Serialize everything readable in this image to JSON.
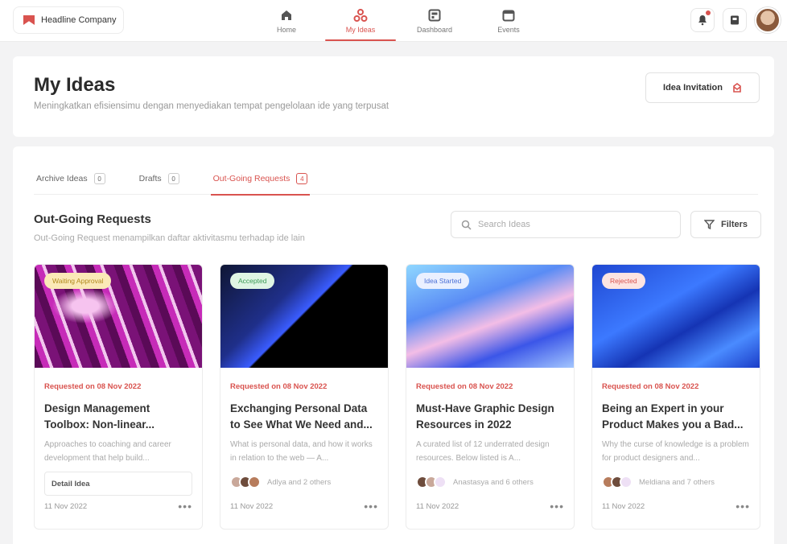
{
  "topbar": {
    "brand": "Headline Company",
    "nav": [
      {
        "label": "Home",
        "icon": "home-icon",
        "active": false
      },
      {
        "label": "My Ideas",
        "icon": "ideas-icon",
        "active": true
      },
      {
        "label": "Dashboard",
        "icon": "dashboard-icon",
        "active": false
      },
      {
        "label": "Events",
        "icon": "calendar-icon",
        "active": false
      }
    ],
    "icons": [
      "notification-icon",
      "bookmark-icon",
      "profile-avatar"
    ]
  },
  "header": {
    "title": "My Ideas",
    "subtitle": "Meningkatkan efisiensimu dengan menyediakan tempat pengelolaan ide yang terpusat",
    "invite_button": "Idea Invitation"
  },
  "tabs": [
    {
      "label": "Archive Ideas",
      "count": "0",
      "active": false
    },
    {
      "label": "Drafts",
      "count": "0",
      "active": false
    },
    {
      "label": "Out-Going Requests",
      "count": "4",
      "active": true
    }
  ],
  "section": {
    "title": "Out-Going Requests",
    "subtitle": "Out-Going Request menampilkan daftar aktivitasmu terhadap ide lain",
    "search_placeholder": "Search Ideas",
    "filter_label": "Filters"
  },
  "cards": [
    {
      "badge": "Waiting Approval",
      "badge_bg": "#fbe9b7",
      "badge_color": "#b0891d",
      "requested": "Requested on 08 Nov 2022",
      "title": "Design Management Toolbox: Non-linear...",
      "description": "Approaches to coaching and career development that help build...",
      "people": "",
      "detail_label": "Detail Idea",
      "date": "11 Nov 2022"
    },
    {
      "badge": "Accepted",
      "badge_bg": "#dff5e4",
      "badge_color": "#3b9a55",
      "requested": "Requested on 08 Nov 2022",
      "title": "Exchanging Personal Data to See What We Need and...",
      "description": "What is personal data, and how it works in relation to the web — A...",
      "people": "Adlya and 2 others",
      "detail_label": "",
      "date": "11 Nov 2022"
    },
    {
      "badge": "Idea Started",
      "badge_bg": "#eaf0ff",
      "badge_color": "#4a6fd6",
      "requested": "Requested on 08 Nov 2022",
      "title": "Must-Have Graphic Design Resources in 2022",
      "description": "A curated list of 12 underrated design resources. Below listed is A...",
      "people": "Anastasya and 6 others",
      "detail_label": "",
      "date": "11 Nov 2022"
    },
    {
      "badge": "Rejected",
      "badge_bg": "#fde4e2",
      "badge_color": "#d9534f",
      "requested": "Requested on 08 Nov 2022",
      "title": "Being an Expert in your Product Makes you a Bad...",
      "description": "Why the curse of knowledge is a problem for product designers and...",
      "people": "Meldiana and 7 others",
      "detail_label": "",
      "date": "11 Nov 2022"
    }
  ],
  "colors": {
    "accent": "#d9534f",
    "background": "#f3f3f4"
  }
}
